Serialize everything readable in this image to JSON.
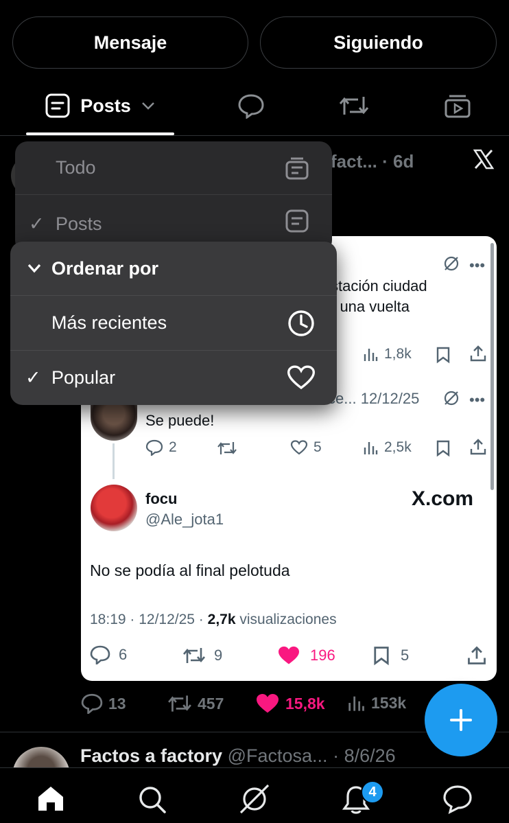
{
  "profile_actions": {
    "message_label": "Mensaje",
    "following_label": "Siguiendo"
  },
  "tabs": {
    "posts_label": "Posts"
  },
  "behind_post": {
    "author_partial": "fact...",
    "time": "· 6d"
  },
  "filter_menu": {
    "todo_label": "Todo",
    "posts_label": "Posts"
  },
  "sort_menu": {
    "header_label": "Ordenar por",
    "recent_label": "Más recientes",
    "popular_label": "Popular",
    "selected": "Popular"
  },
  "embedded": {
    "top_post": {
      "line1": "stación ciudad",
      "line2": "r una vuelta",
      "views": "1,8k"
    },
    "reply_post": {
      "author_partial": "ce...",
      "time": "12/12/25",
      "text": "Se puede!",
      "replies": "2",
      "likes": "5",
      "views": "2,5k"
    },
    "main_post": {
      "name": "focu",
      "handle": "@Ale_jota1",
      "watermark": "X.com",
      "text": "No se podía al final pelotuda",
      "time": "18:19 · 12/12/25 ·",
      "views_count": "2,7k",
      "views_label": "visualizaciones",
      "replies": "6",
      "reposts": "9",
      "likes": "196",
      "bookmarks": "5"
    }
  },
  "outer_stats": {
    "replies": "13",
    "reposts": "457",
    "likes": "15,8k",
    "views": "153k"
  },
  "next_post": {
    "name": "Factos a factory",
    "handle": "@Factosa...",
    "time": "· 8/6/26"
  },
  "bottom_nav": {
    "notif_badge": "4"
  },
  "colors": {
    "like_pink": "#f91880",
    "fab_blue": "#1d9bf0",
    "background": "#000000"
  }
}
